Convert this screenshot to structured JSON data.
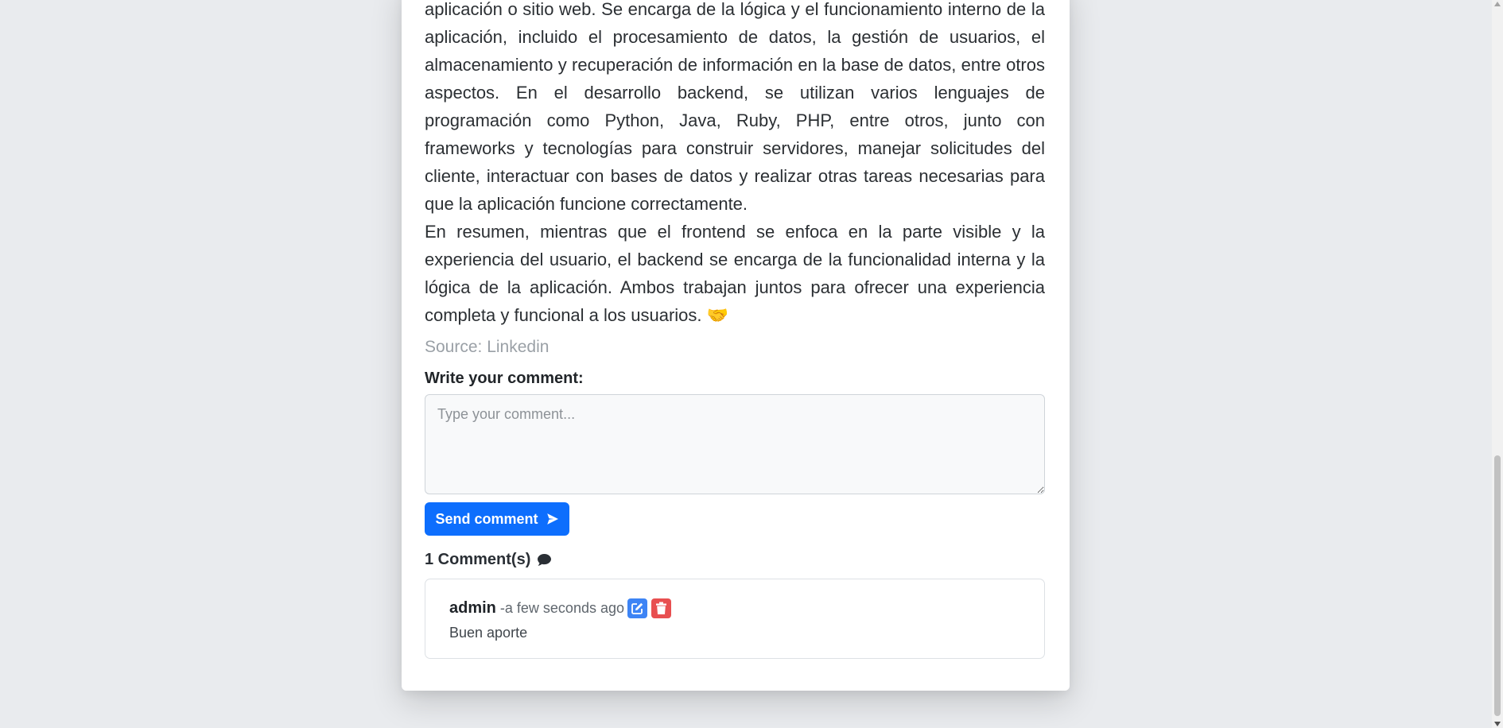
{
  "article": {
    "paragraph_1": "aplicación o sitio web. Se encarga de la lógica y el funcionamiento interno de la aplicación, incluido el procesamiento de datos, la gestión de usuarios, el almacenamiento y recuperación de información en la base de datos, entre otros aspectos. En el desarrollo backend, se utilizan varios lenguajes de programación como Python, Java, Ruby, PHP, entre otros, junto con frameworks y tecnologías para construir servidores, manejar solicitudes del cliente, interactuar con bases de datos y realizar otras tareas necesarias para que la aplicación funcione correctamente.",
    "paragraph_2": "En resumen, mientras que el frontend se enfoca en la parte visible y la experiencia del usuario, el backend se encarga de la funcionalidad interna y la lógica de la aplicación. Ambos trabajan juntos para ofrecer una experiencia completa y funcional a los usuarios. 🤝",
    "source": "Source: Linkedin"
  },
  "comment_form": {
    "label": "Write your comment:",
    "placeholder": "Type your comment...",
    "value": "",
    "send_label": "Send comment"
  },
  "comments_section": {
    "count_label": "1 Comment(s)",
    "icon": "comment-icon",
    "items": [
      {
        "author": "admin",
        "time": "-a few seconds ago",
        "text": "Buen aporte",
        "edit_icon": "edit-icon",
        "delete_icon": "trash-icon"
      }
    ]
  },
  "colors": {
    "primary": "#0d6efd",
    "edit": "#3d84f5",
    "delete": "#e84f50",
    "page_background": "#e9ebee"
  }
}
